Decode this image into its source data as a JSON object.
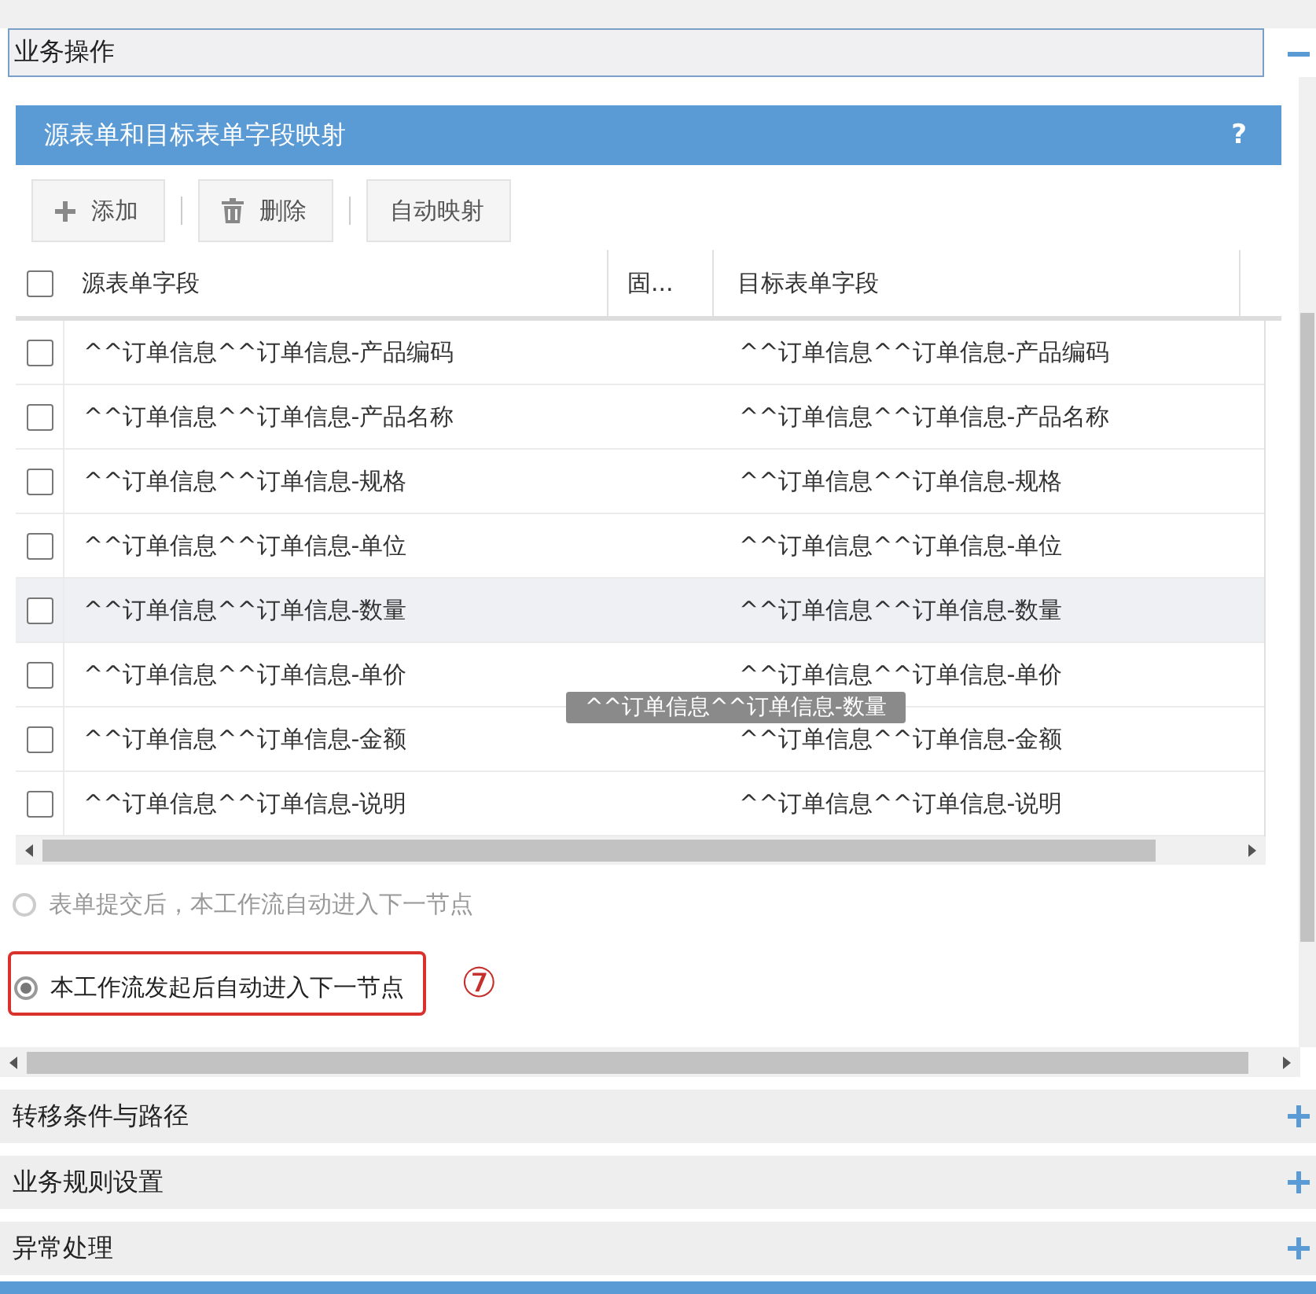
{
  "section": {
    "title": "业务操作",
    "expanded": true
  },
  "panel": {
    "title": "源表单和目标表单字段映射",
    "help": "?"
  },
  "toolbar": [
    {
      "kind": "add",
      "label": "添加"
    },
    {
      "kind": "delete",
      "label": "删除"
    },
    {
      "kind": "plain",
      "label": "自动映射"
    }
  ],
  "table": {
    "all_checked": false,
    "columns": [
      "源表单字段",
      "固...",
      "目标表单字段"
    ],
    "rows": [
      {
        "source": "^^订单信息^^订单信息-产品编码",
        "target": "^^订单信息^^订单信息-产品编码",
        "checked": false,
        "highlighted": false
      },
      {
        "source": "^^订单信息^^订单信息-产品名称",
        "target": "^^订单信息^^订单信息-产品名称",
        "checked": false,
        "highlighted": false
      },
      {
        "source": "^^订单信息^^订单信息-规格",
        "target": "^^订单信息^^订单信息-规格",
        "checked": false,
        "highlighted": false
      },
      {
        "source": "^^订单信息^^订单信息-单位",
        "target": "^^订单信息^^订单信息-单位",
        "checked": false,
        "highlighted": false
      },
      {
        "source": "^^订单信息^^订单信息-数量",
        "target": "^^订单信息^^订单信息-数量",
        "checked": false,
        "highlighted": true
      },
      {
        "source": "^^订单信息^^订单信息-单价",
        "target": "^^订单信息^^订单信息-单价",
        "checked": false,
        "highlighted": false
      },
      {
        "source": "^^订单信息^^订单信息-金额",
        "target": "^^订单信息^^订单信息-金额",
        "checked": false,
        "highlighted": false
      },
      {
        "source": "^^订单信息^^订单信息-说明",
        "target": "^^订单信息^^订单信息-说明",
        "checked": false,
        "highlighted": false
      }
    ],
    "tooltip": "^^订单信息^^订单信息-数量"
  },
  "options": [
    {
      "label": "表单提交后，本工作流自动进入下一节点",
      "selected": false,
      "disabled": true,
      "annotated": false
    },
    {
      "label": "本工作流发起后自动进入下一节点",
      "selected": true,
      "disabled": false,
      "annotated": true
    }
  ],
  "annotation": "⑦",
  "sections": [
    {
      "title": "转移条件与路径",
      "expanded": false
    },
    {
      "title": "业务规则设置",
      "expanded": false
    },
    {
      "title": "异常处理",
      "expanded": false
    }
  ]
}
